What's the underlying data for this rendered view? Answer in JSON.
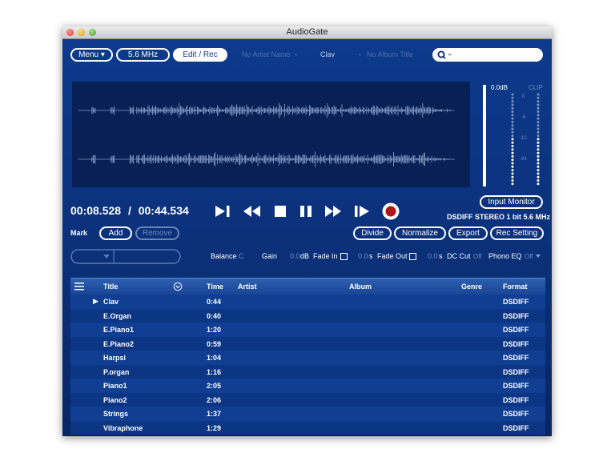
{
  "window": {
    "title": "AudioGate"
  },
  "toolbar": {
    "menu_label": "Menu",
    "samplerate_label": "5.6 MHz",
    "edit_rec_label": "Edit / Rec",
    "artist_placeholder": "No Artist Name",
    "track_title": "Clav",
    "album_placeholder": "No Album Title",
    "dash": "-",
    "search_placeholder": ""
  },
  "meter": {
    "top_label": "0.0dB",
    "clip_label": "CLIP",
    "scale": [
      "0",
      "-6",
      "-12",
      "-24"
    ],
    "input_monitor_label": "Input Monitor"
  },
  "transport": {
    "current_time": "00:08.528",
    "separator": "/",
    "total_time": "00:44.534",
    "format_info": "DSDIFF STEREO 1 bit 5.6 MHz"
  },
  "mark": {
    "label": "Mark",
    "add_label": "Add",
    "remove_label": "Remove"
  },
  "actions": {
    "divide": "Divide",
    "normalize": "Normalize",
    "export": "Export",
    "rec_setting": "Rec Setting"
  },
  "controls": {
    "balance_label": "Balance",
    "balance_value": "C",
    "gain_label": "Gain",
    "gain_value": "0.0",
    "gain_unit": "dB",
    "fadein_label": "Fade In",
    "fadein_value": "0.0",
    "fadeout_label": "Fade Out",
    "fadeout_value": "0.0",
    "seconds_unit": "s",
    "dccut_label": "DC Cut",
    "dccut_value": "Off",
    "phonoeq_label": "Phono EQ",
    "phonoeq_value": "Off"
  },
  "table": {
    "columns": [
      "Title",
      "Time",
      "Artist",
      "Album",
      "Genre",
      "Format"
    ],
    "rows": [
      {
        "title": "Clav",
        "time": "0:44",
        "format": "DSDIFF",
        "playing": true
      },
      {
        "title": "E.Organ",
        "time": "0:40",
        "format": "DSDIFF"
      },
      {
        "title": "E.Piano1",
        "time": "1:20",
        "format": "DSDIFF"
      },
      {
        "title": "E.Piano2",
        "time": "0:59",
        "format": "DSDIFF"
      },
      {
        "title": "Harpsi",
        "time": "1:04",
        "format": "DSDIFF"
      },
      {
        "title": "P.organ",
        "time": "1:16",
        "format": "DSDIFF"
      },
      {
        "title": "Piano1",
        "time": "2:05",
        "format": "DSDIFF"
      },
      {
        "title": "Piano2",
        "time": "2:06",
        "format": "DSDIFF"
      },
      {
        "title": "Strings",
        "time": "1:37",
        "format": "DSDIFF"
      },
      {
        "title": "Vibraphone",
        "time": "1:29",
        "format": "DSDIFF"
      }
    ]
  },
  "colors": {
    "background": "#0d3a8c",
    "waveform": "#8fa6d0",
    "record": "#b0151a"
  }
}
